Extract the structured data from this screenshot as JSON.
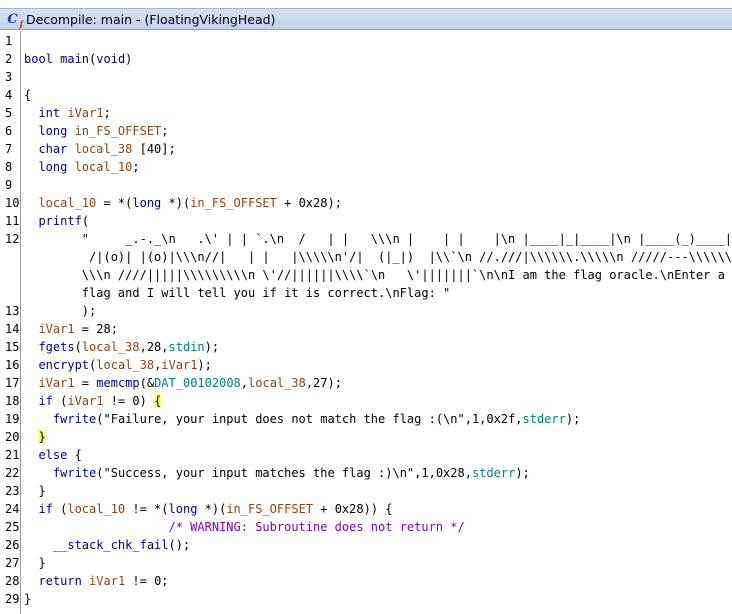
{
  "window": {
    "title": "Decompile: main - (FloatingVikingHead)",
    "icon": "ghidra-decompiler-icon",
    "icon_letter": "C",
    "icon_sub": "f"
  },
  "code": {
    "line_numbers": [
      "1",
      "2",
      "3",
      "4",
      "5",
      "6",
      "7",
      "8",
      "9",
      "10",
      "11",
      "12",
      "",
      "",
      "",
      "13",
      "14",
      "15",
      "16",
      "17",
      "18",
      "19",
      "20",
      "21",
      "22",
      "23",
      "24",
      "25",
      "26",
      "27",
      "28",
      "29"
    ],
    "lines": [
      [],
      [
        {
          "t": "bool ",
          "c": "type"
        },
        {
          "t": "main",
          "c": "fn"
        },
        {
          "t": "(",
          "c": ""
        },
        {
          "t": "void",
          "c": "type"
        },
        {
          "t": ")",
          "c": ""
        }
      ],
      [],
      [
        {
          "t": "{",
          "c": ""
        }
      ],
      [
        {
          "t": "  int ",
          "c": "type"
        },
        {
          "t": "iVar1",
          "c": "var"
        },
        {
          "t": ";",
          "c": ""
        }
      ],
      [
        {
          "t": "  long ",
          "c": "type"
        },
        {
          "t": "in_FS_OFFSET",
          "c": "var"
        },
        {
          "t": ";",
          "c": ""
        }
      ],
      [
        {
          "t": "  char ",
          "c": "type"
        },
        {
          "t": "local_38",
          "c": "var"
        },
        {
          "t": " [40];",
          "c": ""
        }
      ],
      [
        {
          "t": "  long ",
          "c": "type"
        },
        {
          "t": "local_10",
          "c": "var"
        },
        {
          "t": ";",
          "c": ""
        }
      ],
      [],
      [
        {
          "t": "  ",
          "c": ""
        },
        {
          "t": "local_10",
          "c": "var"
        },
        {
          "t": " = *(",
          "c": ""
        },
        {
          "t": "long",
          "c": "type"
        },
        {
          "t": " *)(",
          "c": ""
        },
        {
          "t": "in_FS_OFFSET",
          "c": "var"
        },
        {
          "t": " + 0x28);",
          "c": ""
        }
      ],
      [
        {
          "t": "  ",
          "c": ""
        },
        {
          "t": "printf",
          "c": "fn"
        },
        {
          "t": "(",
          "c": ""
        }
      ],
      [
        {
          "t": "        \"     _.-._\\n   .\\' | | `.\\n  /   | |   \\\\\\n |    | |    |\\n |____|_|____|\\n |____(_)____|\\n",
          "c": "str"
        }
      ],
      [
        {
          "t": "         /|(o)| |(o)|\\\\\\n//|   | |   |\\\\\\\\\\n'/|  (|_|)  |\\\\`\\n //.///|\\\\\\\\\\\\.\\\\\\\\\\n /////---\\\\\\\\\\\\",
          "c": "str"
        }
      ],
      [
        {
          "t": "        \\\\\\n ////|||||\\\\\\\\\\\\\\\\\\n \\'//||||||\\\\\\\\`\\n   \\'|||||||`\\n\\nI am the flag oracle.\\nEnter a",
          "c": "str"
        }
      ],
      [
        {
          "t": "        flag and I will tell you if it is correct.\\nFlag: \"",
          "c": "str"
        }
      ],
      [
        {
          "t": "        );",
          "c": ""
        }
      ],
      [
        {
          "t": "  ",
          "c": ""
        },
        {
          "t": "iVar1",
          "c": "var"
        },
        {
          "t": " = 28;",
          "c": ""
        }
      ],
      [
        {
          "t": "  ",
          "c": ""
        },
        {
          "t": "fgets",
          "c": "fn"
        },
        {
          "t": "(",
          "c": ""
        },
        {
          "t": "local_38",
          "c": "var"
        },
        {
          "t": ",28,",
          "c": ""
        },
        {
          "t": "stdin",
          "c": "global"
        },
        {
          "t": ");",
          "c": ""
        }
      ],
      [
        {
          "t": "  ",
          "c": ""
        },
        {
          "t": "encrypt",
          "c": "fn"
        },
        {
          "t": "(",
          "c": ""
        },
        {
          "t": "local_38",
          "c": "var"
        },
        {
          "t": ",",
          "c": ""
        },
        {
          "t": "iVar1",
          "c": "var"
        },
        {
          "t": ");",
          "c": ""
        }
      ],
      [
        {
          "t": "  ",
          "c": ""
        },
        {
          "t": "iVar1",
          "c": "var"
        },
        {
          "t": " = ",
          "c": ""
        },
        {
          "t": "memcmp",
          "c": "fn"
        },
        {
          "t": "(&",
          "c": ""
        },
        {
          "t": "DAT_00102008",
          "c": "global"
        },
        {
          "t": ",",
          "c": ""
        },
        {
          "t": "local_38",
          "c": "var"
        },
        {
          "t": ",27);",
          "c": ""
        }
      ],
      [
        {
          "t": "  ",
          "c": ""
        },
        {
          "t": "if",
          "c": "kw"
        },
        {
          "t": " (",
          "c": ""
        },
        {
          "t": "iVar1",
          "c": "var"
        },
        {
          "t": " != 0) ",
          "c": ""
        },
        {
          "t": "{",
          "c": "cursor-brace"
        }
      ],
      [
        {
          "t": "    ",
          "c": ""
        },
        {
          "t": "fwrite",
          "c": "fn"
        },
        {
          "t": "(\"Failure, your input does not match the flag :(\\n\",1,0x2f,",
          "c": ""
        },
        {
          "t": "stderr",
          "c": "global"
        },
        {
          "t": ");",
          "c": ""
        }
      ],
      [
        {
          "t": "  ",
          "c": ""
        },
        {
          "t": "}",
          "c": "cursor-brace"
        }
      ],
      [
        {
          "t": "  ",
          "c": ""
        },
        {
          "t": "else",
          "c": "kw"
        },
        {
          "t": " {",
          "c": ""
        }
      ],
      [
        {
          "t": "    ",
          "c": ""
        },
        {
          "t": "fwrite",
          "c": "fn"
        },
        {
          "t": "(\"Success, your input matches the flag :)\\n\",1,0x28,",
          "c": ""
        },
        {
          "t": "stderr",
          "c": "global"
        },
        {
          "t": ");",
          "c": ""
        }
      ],
      [
        {
          "t": "  }",
          "c": ""
        }
      ],
      [
        {
          "t": "  ",
          "c": ""
        },
        {
          "t": "if",
          "c": "kw"
        },
        {
          "t": " (",
          "c": ""
        },
        {
          "t": "local_10",
          "c": "var"
        },
        {
          "t": " != *(",
          "c": ""
        },
        {
          "t": "long",
          "c": "type"
        },
        {
          "t": " *)(",
          "c": ""
        },
        {
          "t": "in_FS_OFFSET",
          "c": "var"
        },
        {
          "t": " + 0x28)) {",
          "c": ""
        }
      ],
      [
        {
          "t": "                    ",
          "c": ""
        },
        {
          "t": "/* WARNING: Subroutine does not return */",
          "c": "comment"
        }
      ],
      [
        {
          "t": "    ",
          "c": ""
        },
        {
          "t": "__stack_chk_fail",
          "c": "fn"
        },
        {
          "t": "();",
          "c": ""
        }
      ],
      [
        {
          "t": "  }",
          "c": ""
        }
      ],
      [
        {
          "t": "  ",
          "c": ""
        },
        {
          "t": "return",
          "c": "kw"
        },
        {
          "t": " ",
          "c": ""
        },
        {
          "t": "iVar1",
          "c": "var"
        },
        {
          "t": " != 0;",
          "c": ""
        }
      ],
      [
        {
          "t": "}",
          "c": ""
        }
      ]
    ]
  },
  "colors": {
    "keyword": "#00008b",
    "variable": "#8b4513",
    "global": "#008080",
    "comment": "#8000c0",
    "brace_highlight": "#ffff80"
  }
}
